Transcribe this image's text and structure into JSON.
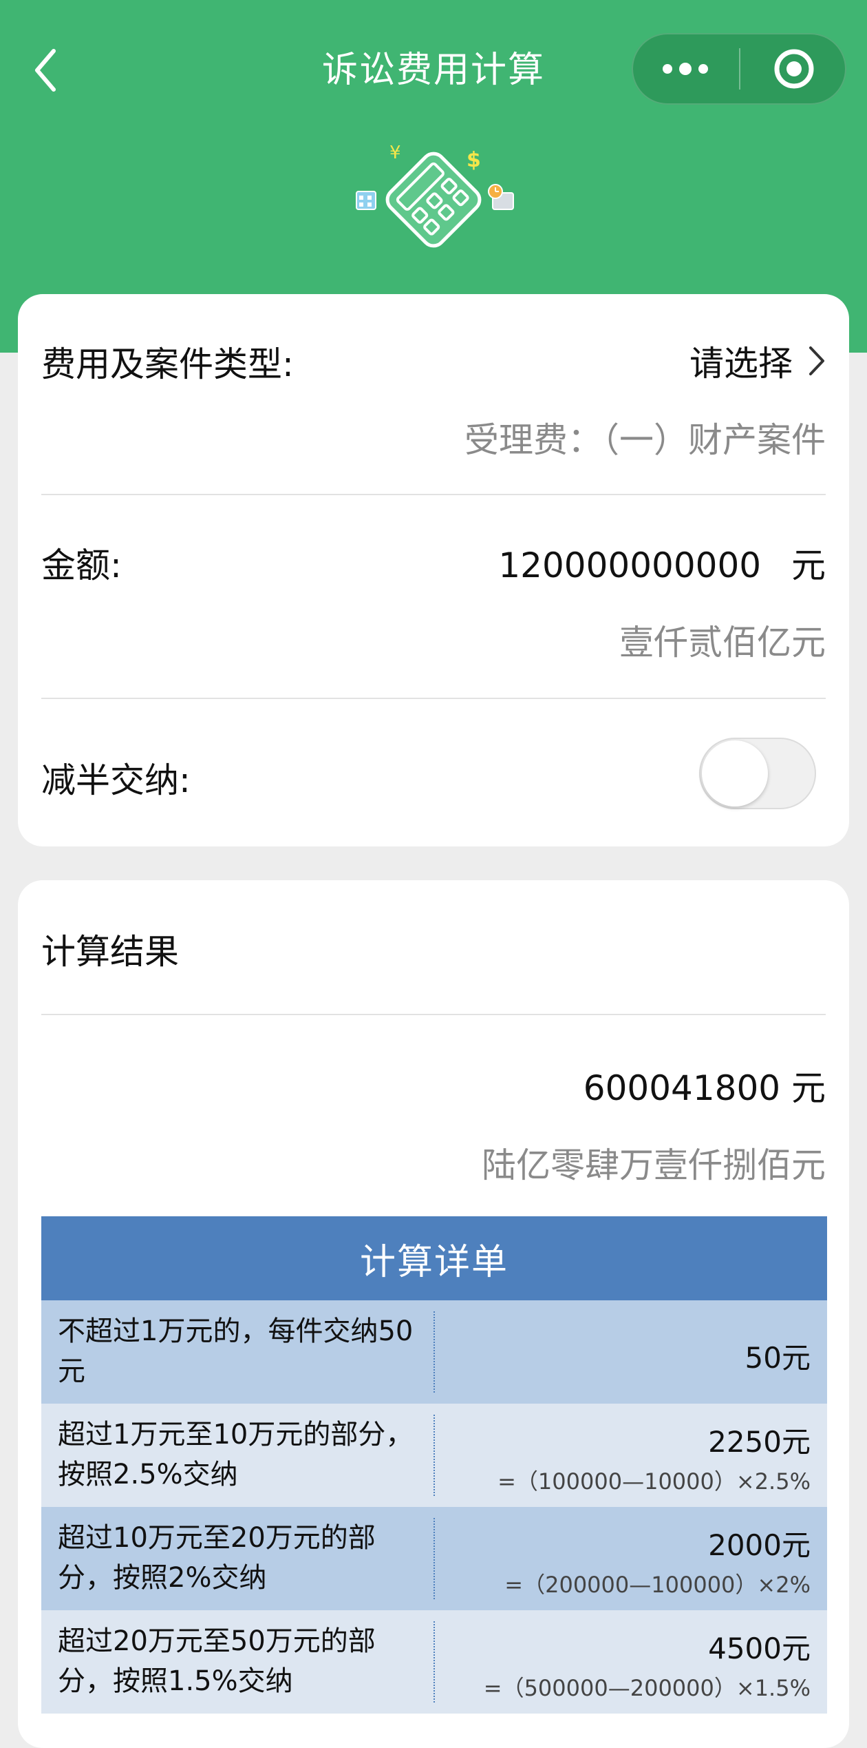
{
  "nav": {
    "title": "诉讼费用计算"
  },
  "form": {
    "type_label": "费用及案件类型:",
    "type_select": "请选择",
    "type_selected": "受理费：（一）财产案件",
    "amount_label": "金额:",
    "amount_value": "120000000000",
    "amount_unit": "元",
    "amount_chinese": "壹仟贰佰亿元",
    "half_label": "减半交纳:",
    "half_enabled": false
  },
  "result": {
    "title": "计算结果",
    "total": "600041800 元",
    "total_chinese": "陆亿零肆万壹仟捌佰元"
  },
  "details": {
    "header": "计算详单",
    "rows": [
      {
        "desc": "不超过1万元的，每件交纳50元",
        "amount": "50元",
        "formula": ""
      },
      {
        "desc": "超过1万元至10万元的部分，按照2.5%交纳",
        "amount": "2250元",
        "formula": "=（100000—10000）×2.5%"
      },
      {
        "desc": "超过10万元至20万元的部分，按照2%交纳",
        "amount": "2000元",
        "formula": "=（200000—100000）×2%"
      },
      {
        "desc": "超过20万元至50万元的部分，按照1.5%交纳",
        "amount": "4500元",
        "formula": "=（500000—200000）×1.5%"
      }
    ]
  },
  "colors": {
    "header_green": "#40b572",
    "table_header_blue": "#4e80bd",
    "row_dark": "#b7cde6",
    "row_light": "#dde6f1"
  }
}
